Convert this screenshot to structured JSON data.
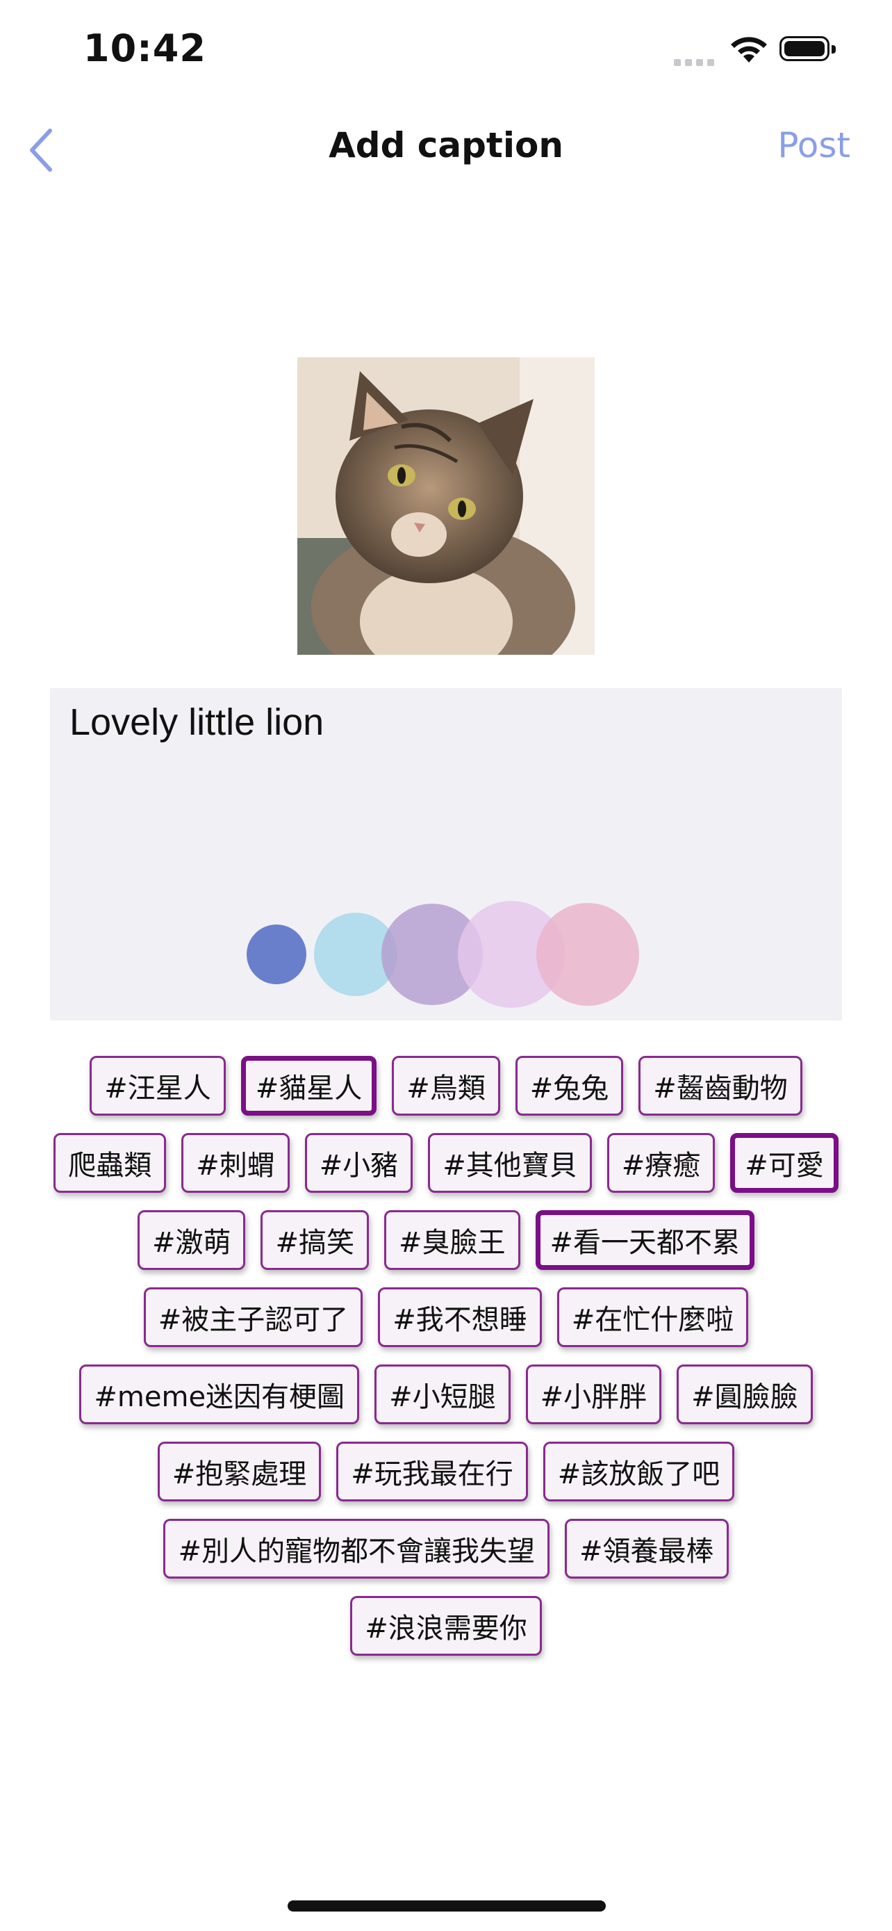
{
  "status_bar": {
    "time": "10:42"
  },
  "nav": {
    "title": "Add caption",
    "post_label": "Post",
    "accent": "#8b9de8"
  },
  "caption": {
    "text": "Lovely little lion"
  },
  "colors": {
    "tag_border": "#8a2a8f",
    "tag_selected_border": "#7a0f86",
    "caption_bg": "#f1f1f5",
    "palette": [
      "#5a72c8",
      "#a8d8ea",
      "#b49ccf",
      "#e6c7ec",
      "#eab2c8"
    ]
  },
  "tags": [
    [
      {
        "label": "#汪星人",
        "selected": false
      },
      {
        "label": "#貓星人",
        "selected": true
      },
      {
        "label": "#鳥類",
        "selected": false
      },
      {
        "label": "#兔兔",
        "selected": false
      },
      {
        "label": "#齧齒動物",
        "selected": false
      }
    ],
    [
      {
        "label": "爬蟲類",
        "selected": false
      },
      {
        "label": "#刺蝟",
        "selected": false
      },
      {
        "label": "#小豬",
        "selected": false
      },
      {
        "label": "#其他寶貝",
        "selected": false
      },
      {
        "label": "#療癒",
        "selected": false
      },
      {
        "label": "#可愛",
        "selected": true
      }
    ],
    [
      {
        "label": "#激萌",
        "selected": false
      },
      {
        "label": "#搞笑",
        "selected": false
      },
      {
        "label": "#臭臉王",
        "selected": false
      },
      {
        "label": "#看一天都不累",
        "selected": true
      }
    ],
    [
      {
        "label": "#被主子認可了",
        "selected": false
      },
      {
        "label": "#我不想睡",
        "selected": false
      },
      {
        "label": "#在忙什麼啦",
        "selected": false
      }
    ],
    [
      {
        "label": "#meme迷因有梗圖",
        "selected": false
      },
      {
        "label": "#小短腿",
        "selected": false
      },
      {
        "label": "#小胖胖",
        "selected": false
      },
      {
        "label": "#圓臉臉",
        "selected": false
      }
    ],
    [
      {
        "label": "#抱緊處理",
        "selected": false
      },
      {
        "label": "#玩我最在行",
        "selected": false
      },
      {
        "label": "#該放飯了吧",
        "selected": false
      }
    ],
    [
      {
        "label": "#別人的寵物都不會讓我失望",
        "selected": false
      },
      {
        "label": "#領養最棒",
        "selected": false
      }
    ],
    [
      {
        "label": "#浪浪需要你",
        "selected": false
      }
    ]
  ]
}
